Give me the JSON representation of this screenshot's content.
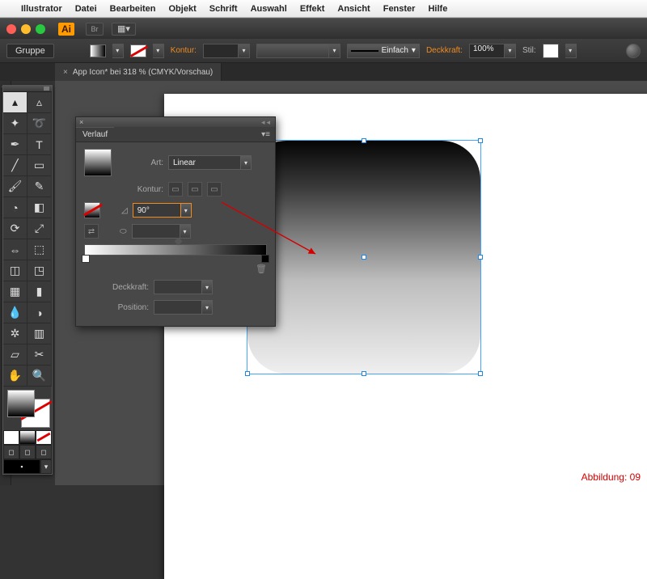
{
  "menubar": {
    "items": [
      "Illustrator",
      "Datei",
      "Bearbeiten",
      "Objekt",
      "Schrift",
      "Auswahl",
      "Effekt",
      "Ansicht",
      "Fenster",
      "Hilfe"
    ]
  },
  "appLogo": "Ai",
  "controlBar": {
    "selection": "Gruppe",
    "konturLabel": "Kontur:",
    "strokeStyle": "Einfach",
    "deckkraftLabel": "Deckkraft:",
    "deckkraftValue": "100%",
    "stilLabel": "Stil:"
  },
  "docTab": "App Icon* bei 318 % (CMYK/Vorschau)",
  "gradientPanel": {
    "title": "Verlauf",
    "artLabel": "Art:",
    "artValue": "Linear",
    "konturLabel": "Kontur:",
    "angleValue": "90°",
    "deckkraftLabel": "Deckkraft:",
    "positionLabel": "Position:"
  },
  "caption": "Abbildung: 09"
}
